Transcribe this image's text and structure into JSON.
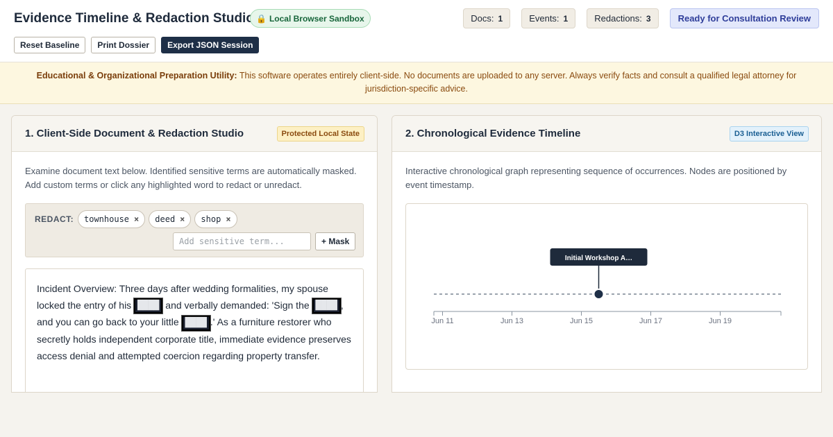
{
  "header": {
    "title": "Evidence Timeline & Redaction Studio",
    "sandbox_icon": "lock-icon",
    "sandbox_label": "Local Browser Sandbox",
    "stats": [
      {
        "label": "Docs:",
        "value": "1"
      },
      {
        "label": "Events:",
        "value": "1"
      },
      {
        "label": "Redactions:",
        "value": "3"
      }
    ],
    "status": "Ready for Consultation Review",
    "buttons": {
      "reset": "Reset Baseline",
      "print": "Print Dossier",
      "export": "Export JSON Session"
    }
  },
  "notice": {
    "lead": "Educational & Organizational Preparation Utility:",
    "text": "This software operates entirely client-side. No documents are uploaded to any server. Always verify facts and consult a qualified legal attorney for jurisdiction-specific advice."
  },
  "redaction_panel": {
    "title": "1. Client-Side Document & Redaction Studio",
    "tag": "Protected Local State",
    "description": "Examine document text below. Identified sensitive terms are automatically masked. Add custom terms or click any highlighted word to redact or unredact.",
    "redact_label": "REDACT:",
    "terms": [
      "townhouse",
      "deed",
      "shop"
    ],
    "remove_symbol": "×",
    "input_placeholder": "Add sensitive term...",
    "mask_button": "+ Mask",
    "mask_glyph": "████",
    "document": {
      "part1": "Incident Overview: Three days after wedding formalities, my spouse locked the entry of his ",
      "part2": " and verbally demanded: 'Sign the ",
      "part3": ", and you can go back to your little ",
      "part4": ".' As a furniture restorer who secretly holds independent corporate title, immediate evidence preserves access denial and attempted coercion regarding property transfer."
    }
  },
  "timeline_panel": {
    "title": "2. Chronological Evidence Timeline",
    "tag": "D3 Interactive View",
    "description": "Interactive chronological graph representing sequence of occurrences. Nodes are positioned by event timestamp."
  },
  "chart_data": {
    "type": "scatter",
    "x_axis": {
      "type": "time",
      "ticks": [
        "Jun 11",
        "Jun 13",
        "Jun 15",
        "Jun 17",
        "Jun 19"
      ],
      "range": [
        "Jun 10.75",
        "Jun 20.75"
      ]
    },
    "events": [
      {
        "date": "Jun 15.5",
        "label": "Initial Workshop A…"
      }
    ],
    "grid": false,
    "colors": {
      "node": "#1e2f47",
      "baseline": "#9aa3ad",
      "label_bg": "#1e2a3b"
    }
  }
}
